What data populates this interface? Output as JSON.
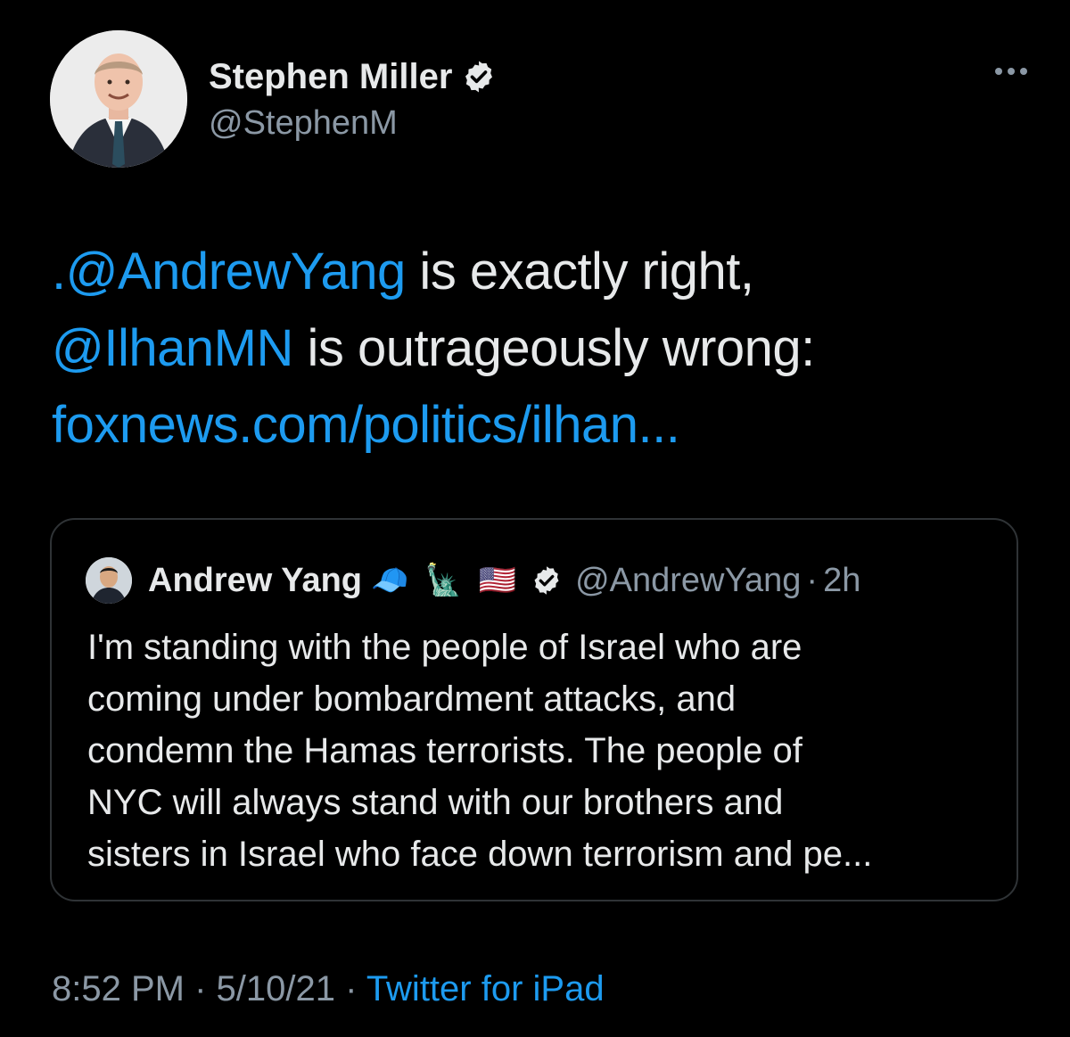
{
  "author": {
    "display_name": "Stephen Miller",
    "handle": "@StephenM",
    "verified": true
  },
  "more_menu_icon": "more-horizontal-icon",
  "tweet": {
    "mention1": ".@AndrewYang",
    "text1": " is exactly right,",
    "mention2": "@IlhanMN",
    "text2": " is outrageously wrong:",
    "link": "foxnews.com/politics/ilhan..."
  },
  "quote": {
    "display_name": "Andrew Yang",
    "emoji_cap": "🧢",
    "emoji_statue": "🗽",
    "emoji_flag": "🇺🇸",
    "handle": "@AndrewYang",
    "separator": "·",
    "time": "2h",
    "lines": [
      "I'm standing with the people of Israel who are",
      "coming under bombardment attacks, and",
      "condemn the Hamas terrorists. The people of",
      "NYC will always stand with our brothers and",
      "sisters in Israel who face down terrorism and pe..."
    ]
  },
  "footer": {
    "time": "8:52 PM",
    "sep1": " · ",
    "date": "5/10/21",
    "sep2": " · ",
    "source": "Twitter for iPad"
  },
  "colors": {
    "background": "#000000",
    "link": "#1d9bf0",
    "muted": "#8b98a5",
    "text": "#e7e9ea",
    "border": "#2f3336"
  }
}
